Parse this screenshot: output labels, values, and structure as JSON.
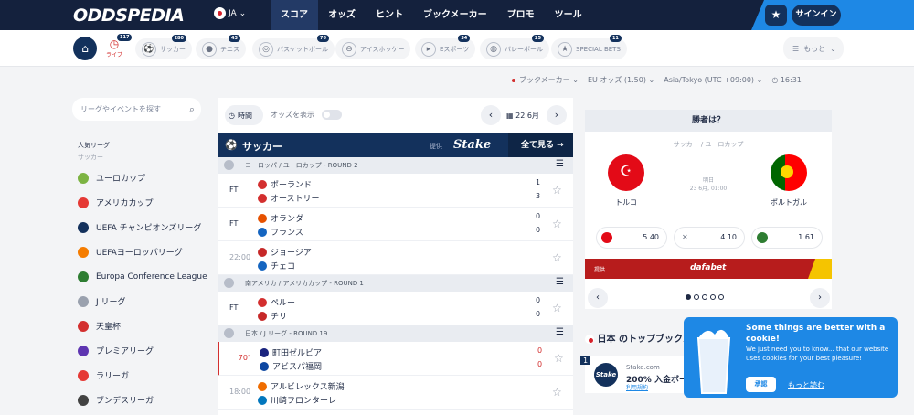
{
  "header": {
    "logo": "ODDSPEDIA",
    "lang": "JA",
    "nav": [
      "スコア",
      "オッズ",
      "ヒント",
      "ブックメーカー",
      "プロモ",
      "ツール"
    ],
    "signin": "サインイン"
  },
  "sports": {
    "live": "ライブ",
    "live_count": "117",
    "items": [
      {
        "label": "サッカー",
        "count": "280",
        "icon": "⚽"
      },
      {
        "label": "テニス",
        "count": "43",
        "icon": "●"
      },
      {
        "label": "バスケットボール",
        "count": "76",
        "icon": "◎"
      },
      {
        "label": "アイスホッケー",
        "count": "",
        "icon": "⊖"
      },
      {
        "label": "Eスポーツ",
        "count": "34",
        "icon": "▸"
      },
      {
        "label": "バレーボール",
        "count": "25",
        "icon": "◍"
      },
      {
        "label": "SPECIAL BETS",
        "count": "11",
        "icon": "★"
      }
    ],
    "more": "もっと"
  },
  "filters": {
    "bookmaker": "ブックメーカー",
    "odds": "EU オッズ (1.50)",
    "tz": "Asia/Tokyo (UTC +09:00)",
    "time": "16:31"
  },
  "search": {
    "placeholder": "リーグやイベントを探す"
  },
  "sidebar": {
    "popular": "人気リーグ",
    "soccer": "サッカー",
    "leagues": [
      {
        "label": "ユーロカップ",
        "color": "#7cb342"
      },
      {
        "label": "アメリカカップ",
        "color": "#e53935"
      },
      {
        "label": "UEFA チャンピオンズリーグ",
        "color": "#13315c"
      },
      {
        "label": "UEFAヨーロッパリーグ",
        "color": "#f57c00"
      },
      {
        "label": "Europa Conference League",
        "color": "#2e7d32"
      },
      {
        "label": "J リーグ",
        "color": "#9aa1ae"
      },
      {
        "label": "天皇杯",
        "color": "#d32f2f"
      },
      {
        "label": "プレミアリーグ",
        "color": "#5e35b1"
      },
      {
        "label": "ラリーガ",
        "color": "#e53935"
      },
      {
        "label": "ブンデスリーガ",
        "color": "#424242"
      }
    ]
  },
  "center": {
    "time_btn": "時間",
    "show_odds": "オッズを表示",
    "date": "22 6月",
    "sport": "サッカー",
    "provided": "提供",
    "stake": "Stake",
    "see_all": "全て見る",
    "groups": [
      {
        "region": "ヨーロッパ",
        "league": "ユーロカップ - ROUND 2",
        "matches": [
          {
            "status": "FT",
            "home": "ポーランド",
            "away": "オーストリー",
            "hs": "1",
            "as": "3",
            "hc": "#d32f2f",
            "ac": "#d32f2f"
          },
          {
            "status": "FT",
            "home": "オランダ",
            "away": "フランス",
            "hs": "0",
            "as": "0",
            "hc": "#e65100",
            "ac": "#1565c0"
          },
          {
            "status": "22:00",
            "home": "ジョージア",
            "away": "チェコ",
            "hs": "",
            "as": "",
            "hc": "#c62828",
            "ac": "#1565c0"
          }
        ]
      },
      {
        "region": "南アメリカ",
        "league": "アメリカカップ - ROUND 1",
        "matches": [
          {
            "status": "FT",
            "home": "ペルー",
            "away": "チリ",
            "hs": "0",
            "as": "0",
            "hc": "#d32f2f",
            "ac": "#c62828"
          }
        ]
      },
      {
        "region": "日本",
        "league": "J リーグ - ROUND 19",
        "matches": [
          {
            "status": "70'",
            "home": "町田ゼルビア",
            "away": "アビスパ福岡",
            "hs": "0",
            "as": "0",
            "hc": "#1a237e",
            "ac": "#0d47a1"
          },
          {
            "status": "18:00",
            "home": "アルビレックス新潟",
            "away": "川崎フロンターレ",
            "hs": "",
            "as": "",
            "hc": "#ef6c00",
            "ac": "#0277bd"
          }
        ]
      }
    ]
  },
  "winner": {
    "title": "勝者は？",
    "competition": "サッカー / ユーロカップ",
    "when": "明日",
    "date": "23 6月, 01:00",
    "home": "トルコ",
    "away": "ポルトガル",
    "odds": [
      "5.40",
      "4.10",
      "1.61"
    ],
    "draw_icon": "✕",
    "provided": "提供",
    "brand": "dafabet"
  },
  "bookmakers": {
    "title": "日本 のトップブックメ",
    "rank": "1",
    "logo": "Stake",
    "name": "Stake.com",
    "bonus": "200% 入金ボー",
    "terms": "利用規約"
  },
  "cookie": {
    "title": "Some things are better with a cookie!",
    "body": "We just need you to know... that our website uses cookies for your best pleasure!",
    "accept": "承認",
    "more": "もっと読む"
  },
  "colors": {
    "navy": "#14213d",
    "accent": "#1e88e5",
    "red": "#d32f2f"
  }
}
